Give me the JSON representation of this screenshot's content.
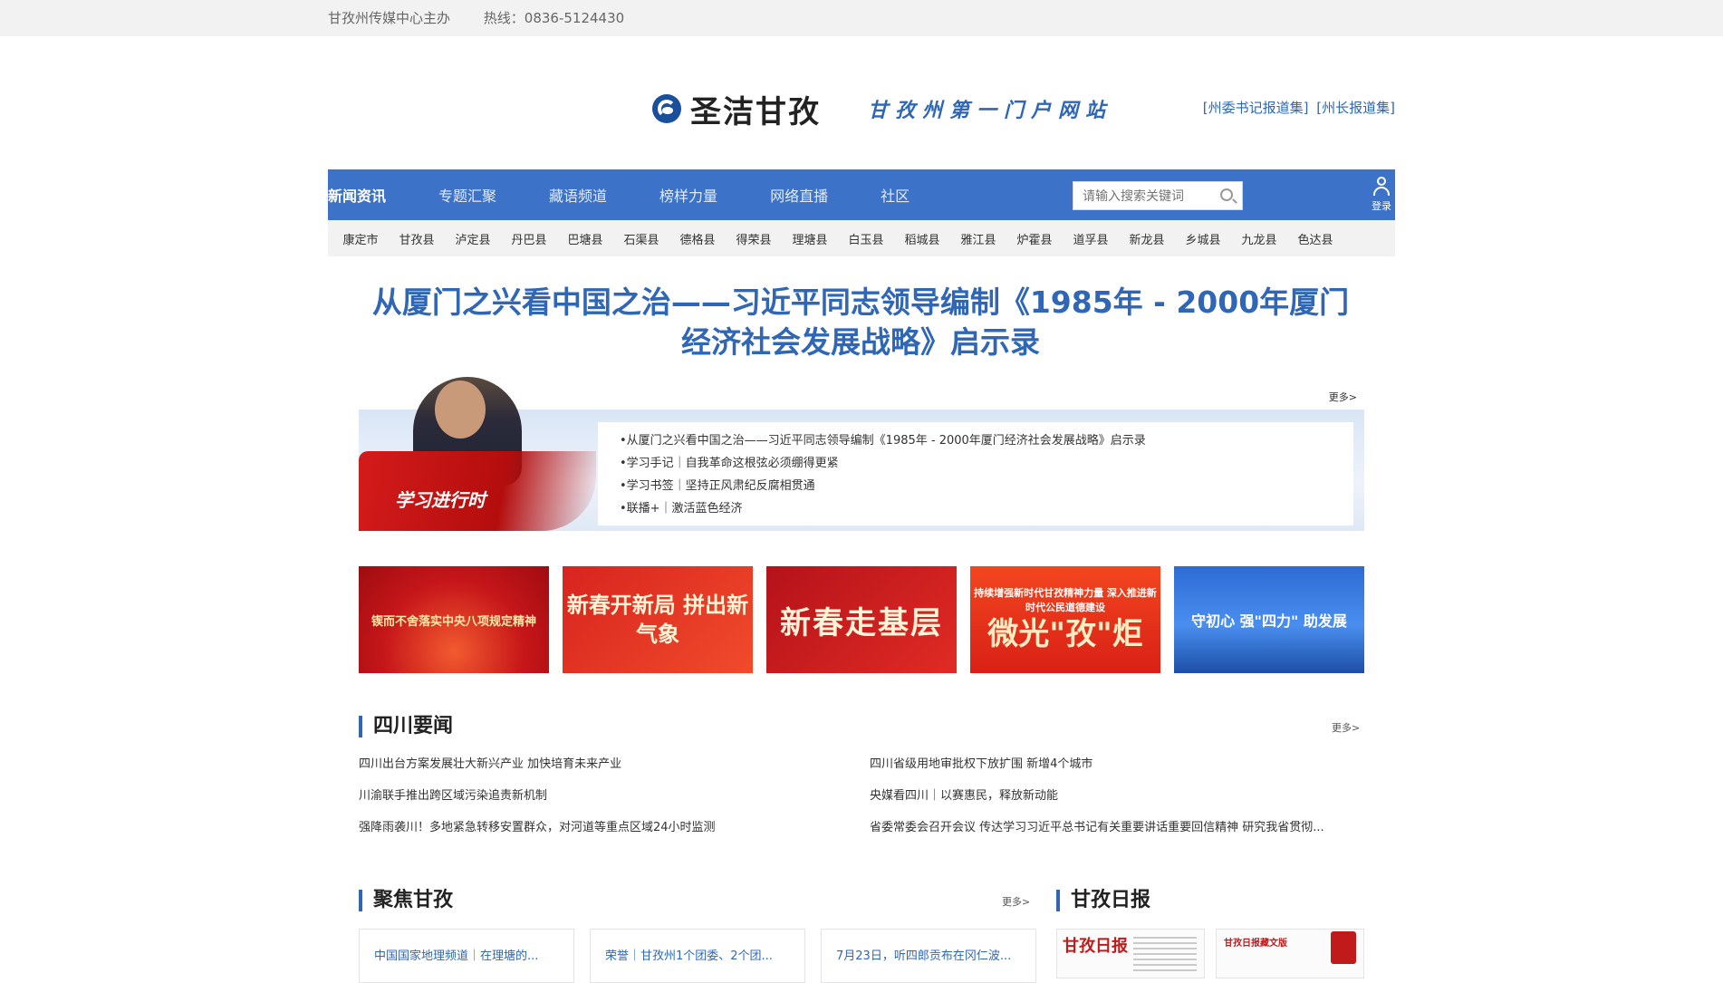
{
  "topbar": {
    "sponsor": "甘孜州传媒中心主办",
    "hotline": "热线：0836-5124430"
  },
  "header": {
    "logo_text": "圣洁甘孜",
    "slogan": "甘孜州第一门户网站",
    "links": [
      "[州委书记报道集]",
      "[州长报道集]"
    ]
  },
  "nav": {
    "items": [
      "新闻资讯",
      "专题汇聚",
      "藏语频道",
      "榜样力量",
      "网络直播",
      "社区"
    ],
    "search_placeholder": "请输入搜索关键词",
    "login_label": "登录"
  },
  "counties": [
    "康定市",
    "甘孜县",
    "泸定县",
    "丹巴县",
    "巴塘县",
    "石渠县",
    "德格县",
    "得荣县",
    "理塘县",
    "白玉县",
    "稻城县",
    "雅江县",
    "炉霍县",
    "道孚县",
    "新龙县",
    "乡城县",
    "九龙县",
    "色达县"
  ],
  "headline": "从厦门之兴看中国之治——习近平同志领导编制《1985年 - 2000年厦门经济社会发展战略》启示录",
  "study": {
    "badge_label": "学习进行时",
    "more": "更多>",
    "items": [
      "•从厦门之兴看中国之治——习近平同志领导编制《1985年 - 2000年厦门经济社会发展战略》启示录",
      "•学习手记｜自我革命这根弦必须绷得更紧",
      "•学习书签｜坚持正风肃纪反腐相贯通",
      "•联播+｜激活蓝色经济"
    ]
  },
  "banners": [
    {
      "text": "锲而不舍落实中央八项规定精神"
    },
    {
      "text": "新春开新局 拼出新气象"
    },
    {
      "text": "新春走基层"
    },
    {
      "small": "持续增强新时代甘孜精神力量 深入推进新时代公民道德建设",
      "big": "微光\"孜\"炬"
    },
    {
      "text": "守初心 强\"四力\" 助发展"
    }
  ],
  "sichuan": {
    "title": "四川要闻",
    "more": "更多>",
    "left": [
      "四川出台方案发展壮大新兴产业 加快培育未来产业",
      "川渝联手推出跨区域污染追责新机制",
      "强降雨袭川！多地紧急转移安置群众，对河道等重点区域24小时监测"
    ],
    "right": [
      "四川省级用地审批权下放扩围 新增4个城市",
      "央媒看四川｜以赛惠民，释放新动能",
      "省委常委会召开会议 传达学习习近平总书记有关重要讲话重要回信精神 研究我省贯彻..."
    ]
  },
  "focus": {
    "title": "聚焦甘孜",
    "more": "更多>",
    "cards": [
      "中国国家地理频道｜在理塘的...",
      "荣誉｜甘孜州1个团委、2个团...",
      "7月23日，听四郎贡布在冈仁波..."
    ]
  },
  "daily": {
    "title": "甘孜日报",
    "masthead": "甘孜日报",
    "masthead2": "甘孜日报藏文版"
  }
}
